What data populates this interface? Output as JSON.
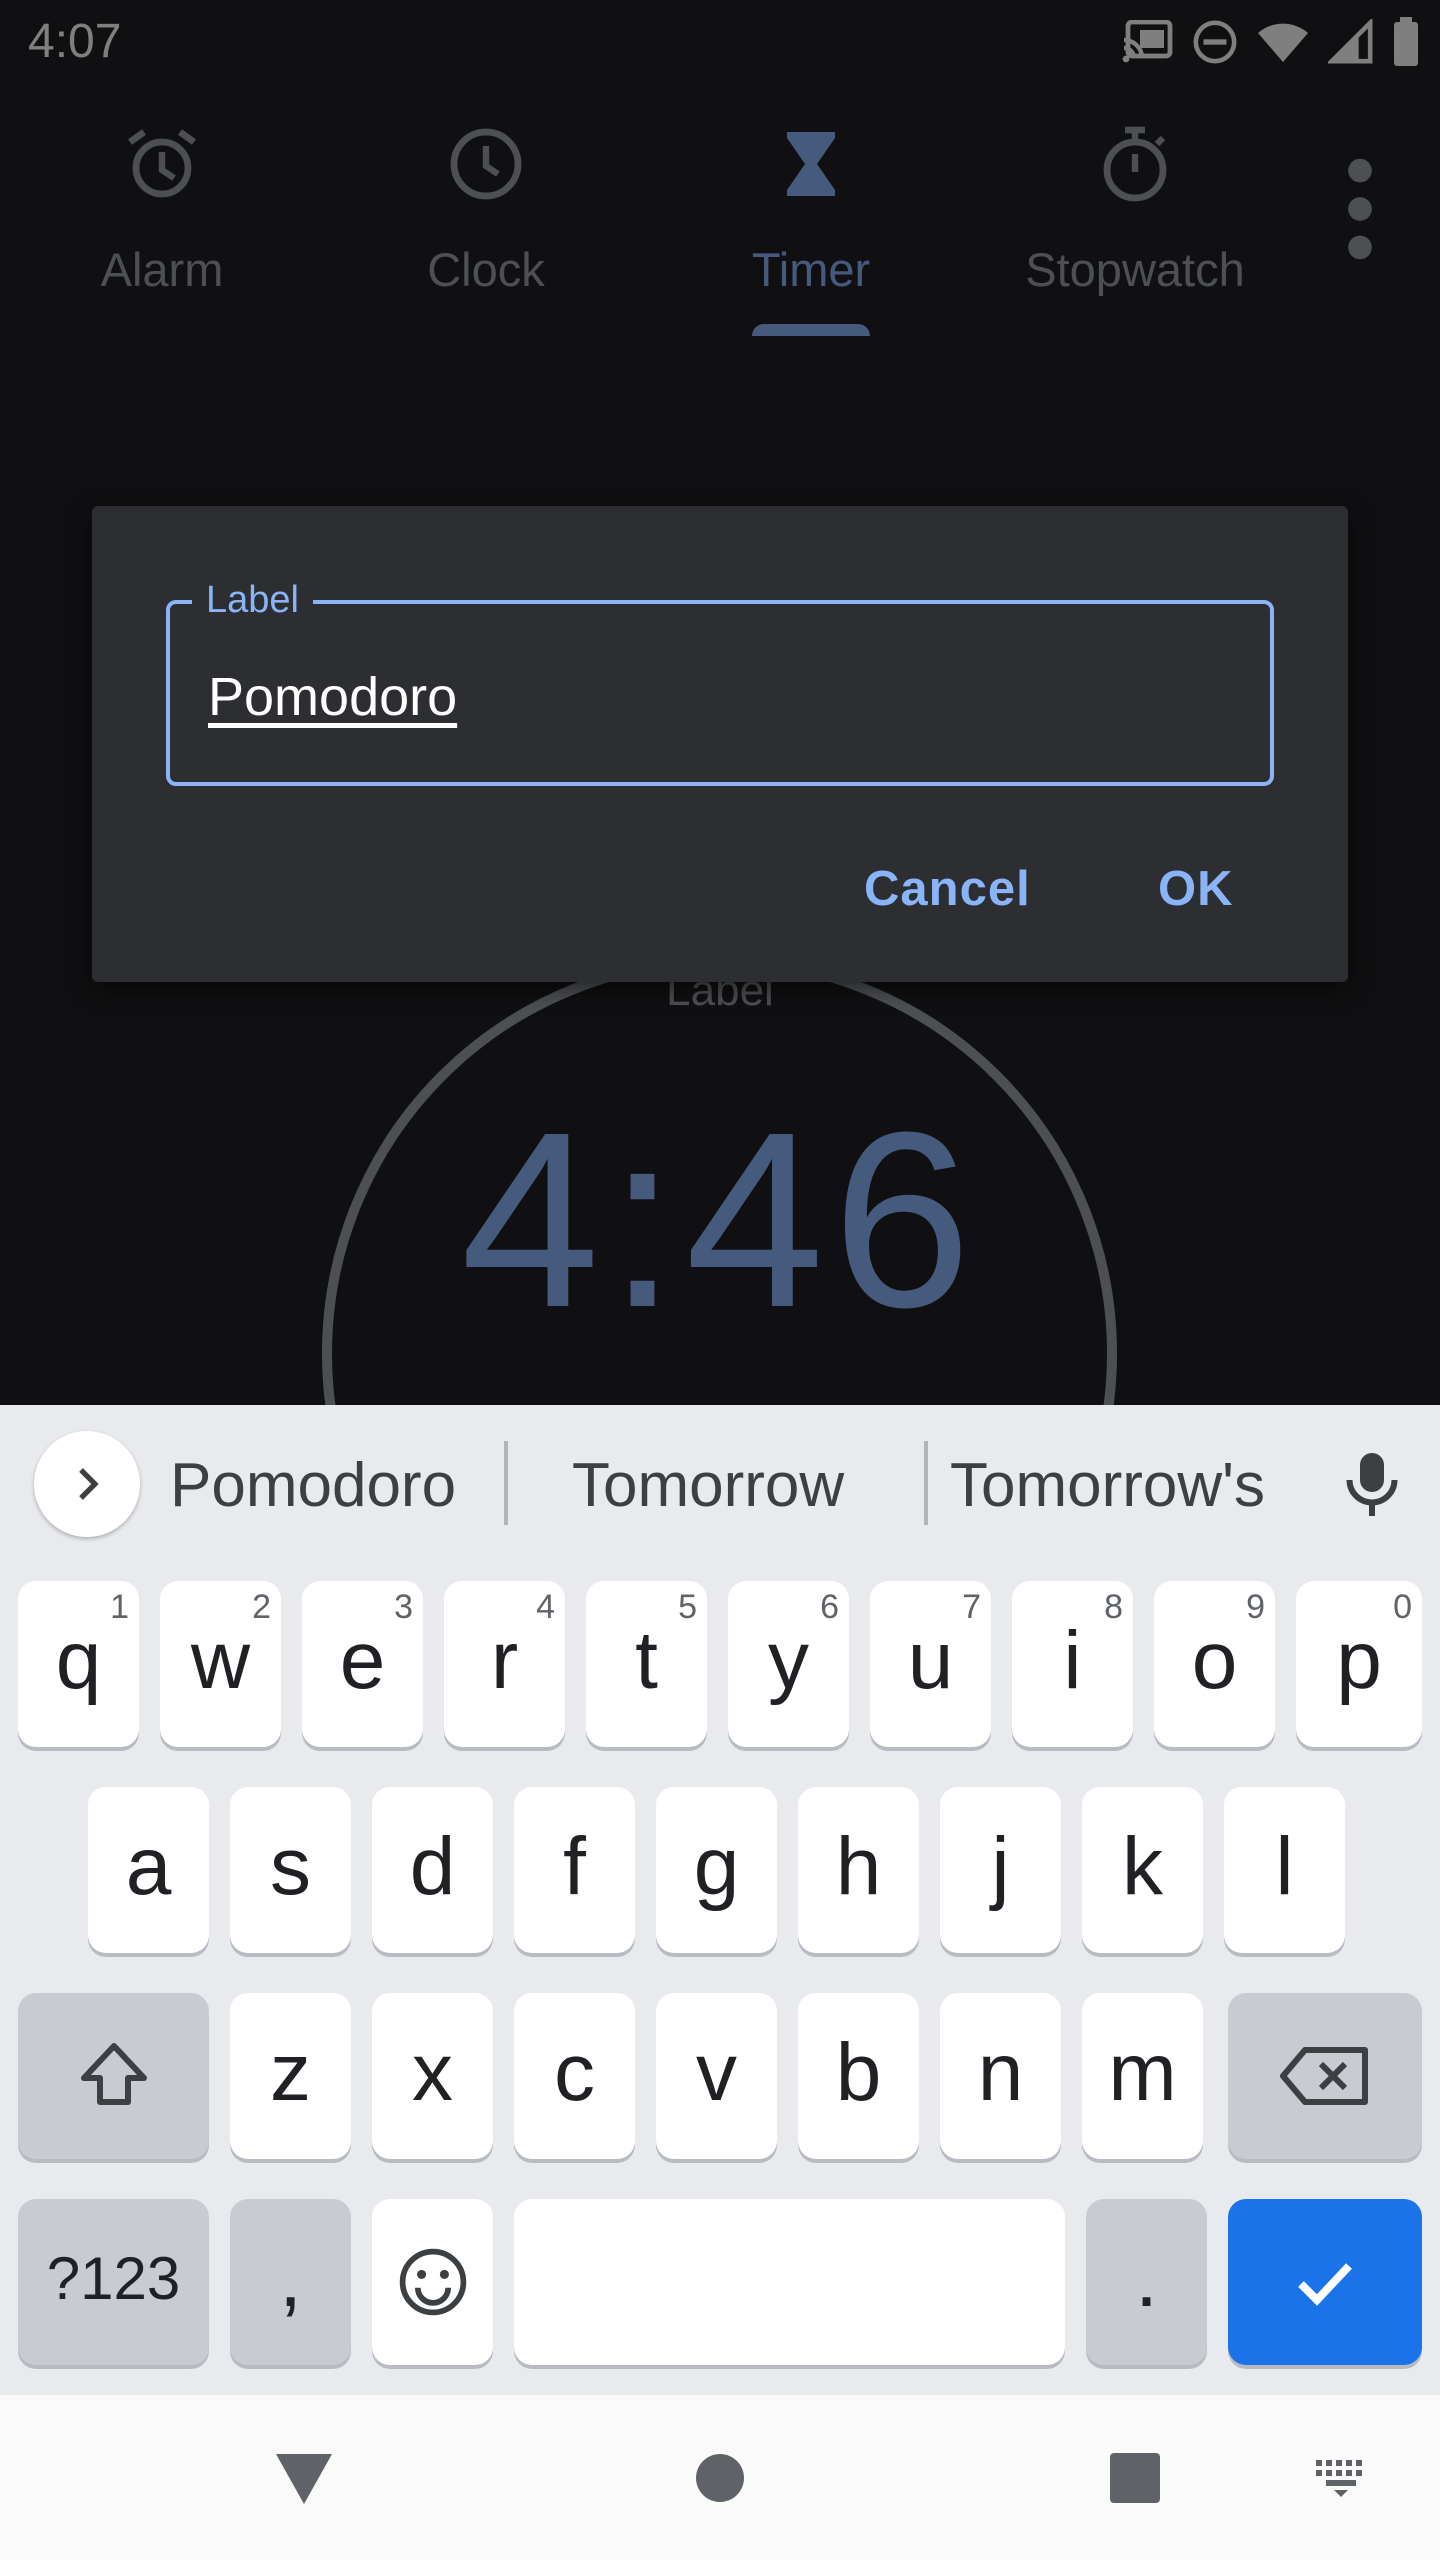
{
  "status_bar": {
    "time": "4:07",
    "icons": [
      "cast-icon",
      "do-not-disturb-icon",
      "wifi-icon",
      "signal-icon",
      "battery-icon"
    ]
  },
  "tabs": [
    {
      "label": "Alarm",
      "icon": "alarm-icon",
      "active": false
    },
    {
      "label": "Clock",
      "icon": "clock-icon",
      "active": false
    },
    {
      "label": "Timer",
      "icon": "hourglass-icon",
      "active": true
    },
    {
      "label": "Stopwatch",
      "icon": "stopwatch-icon",
      "active": false
    }
  ],
  "timer": {
    "label": "Label",
    "time": "4:46"
  },
  "dialog": {
    "field_label": "Label",
    "field_value": "Pomodoro",
    "cancel_label": "Cancel",
    "ok_label": "OK"
  },
  "keyboard": {
    "suggestions": [
      "Pomodoro",
      "Tomorrow",
      "Tomorrow's"
    ],
    "row1": [
      {
        "key": "q",
        "hint": "1"
      },
      {
        "key": "w",
        "hint": "2"
      },
      {
        "key": "e",
        "hint": "3"
      },
      {
        "key": "r",
        "hint": "4"
      },
      {
        "key": "t",
        "hint": "5"
      },
      {
        "key": "y",
        "hint": "6"
      },
      {
        "key": "u",
        "hint": "7"
      },
      {
        "key": "i",
        "hint": "8"
      },
      {
        "key": "o",
        "hint": "9"
      },
      {
        "key": "p",
        "hint": "0"
      }
    ],
    "row2": [
      "a",
      "s",
      "d",
      "f",
      "g",
      "h",
      "j",
      "k",
      "l"
    ],
    "row3": [
      "z",
      "x",
      "c",
      "v",
      "b",
      "n",
      "m"
    ],
    "symbols_label": "?123",
    "comma_label": ",",
    "period_label": "."
  },
  "colors": {
    "accent": "#8ab4f8",
    "enter_key": "#1a73e8",
    "dialog_bg": "#2d2e31"
  }
}
